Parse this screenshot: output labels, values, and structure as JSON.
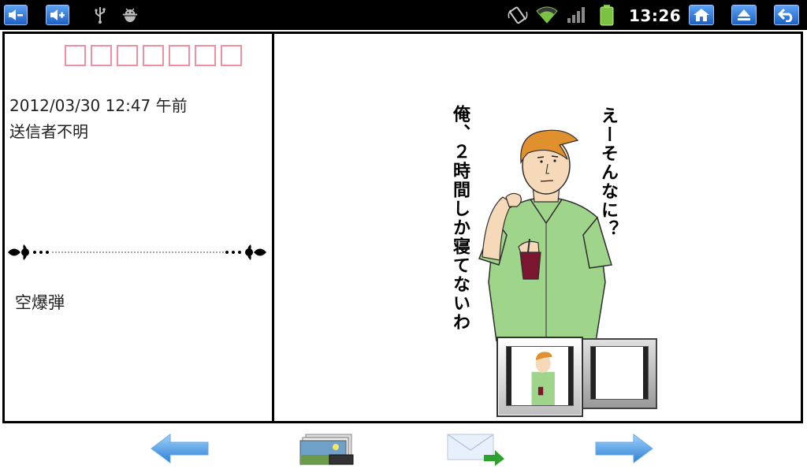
{
  "status_bar": {
    "time": "13:26",
    "left_icons": [
      "volume-down-icon",
      "volume-up-icon",
      "usb-icon",
      "android-debug-icon"
    ],
    "right_icons": [
      "rotation-lock-icon",
      "wifi-icon",
      "signal-icon",
      "battery-icon",
      "home-icon",
      "menu-icon",
      "back-icon"
    ]
  },
  "mail": {
    "stamp_box_count": 7,
    "date": "2012/03/30 12:47 午前",
    "sender": "送信者不明",
    "subject": "空爆弾"
  },
  "image": {
    "speech_left": "俺、２時間しか寝てないわ",
    "speech_right": "えーそんなに？"
  },
  "bottom_nav": [
    "previous-arrow-icon",
    "gallery-icon",
    "send-mail-icon",
    "next-arrow-icon"
  ]
}
